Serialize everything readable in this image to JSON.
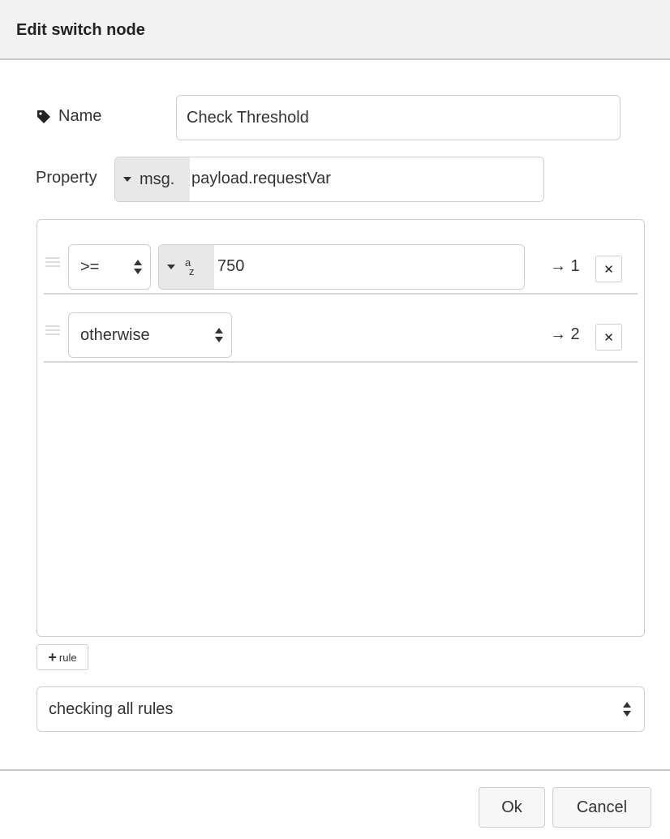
{
  "dialog": {
    "title": "Edit switch node"
  },
  "name_field": {
    "label": "Name",
    "icon": "tag-icon",
    "value": "Check Threshold"
  },
  "property_field": {
    "label": "Property",
    "type": "msg.",
    "value": "payload.requestVar"
  },
  "rules": [
    {
      "operator": "&gt;=",
      "value_type_icon": "string-az-icon",
      "value": "750",
      "port": "→ 1"
    },
    {
      "operator": "otherwise",
      "port": "→ 2"
    }
  ],
  "add_rule_label": "rule",
  "checking_mode": "checking all rules",
  "buttons": {
    "ok": "Ok",
    "cancel": "Cancel"
  },
  "colors": {
    "header_bg": "#f2f2f2",
    "type_bg": "#e8e8e8",
    "border": "#cfcfcf"
  }
}
